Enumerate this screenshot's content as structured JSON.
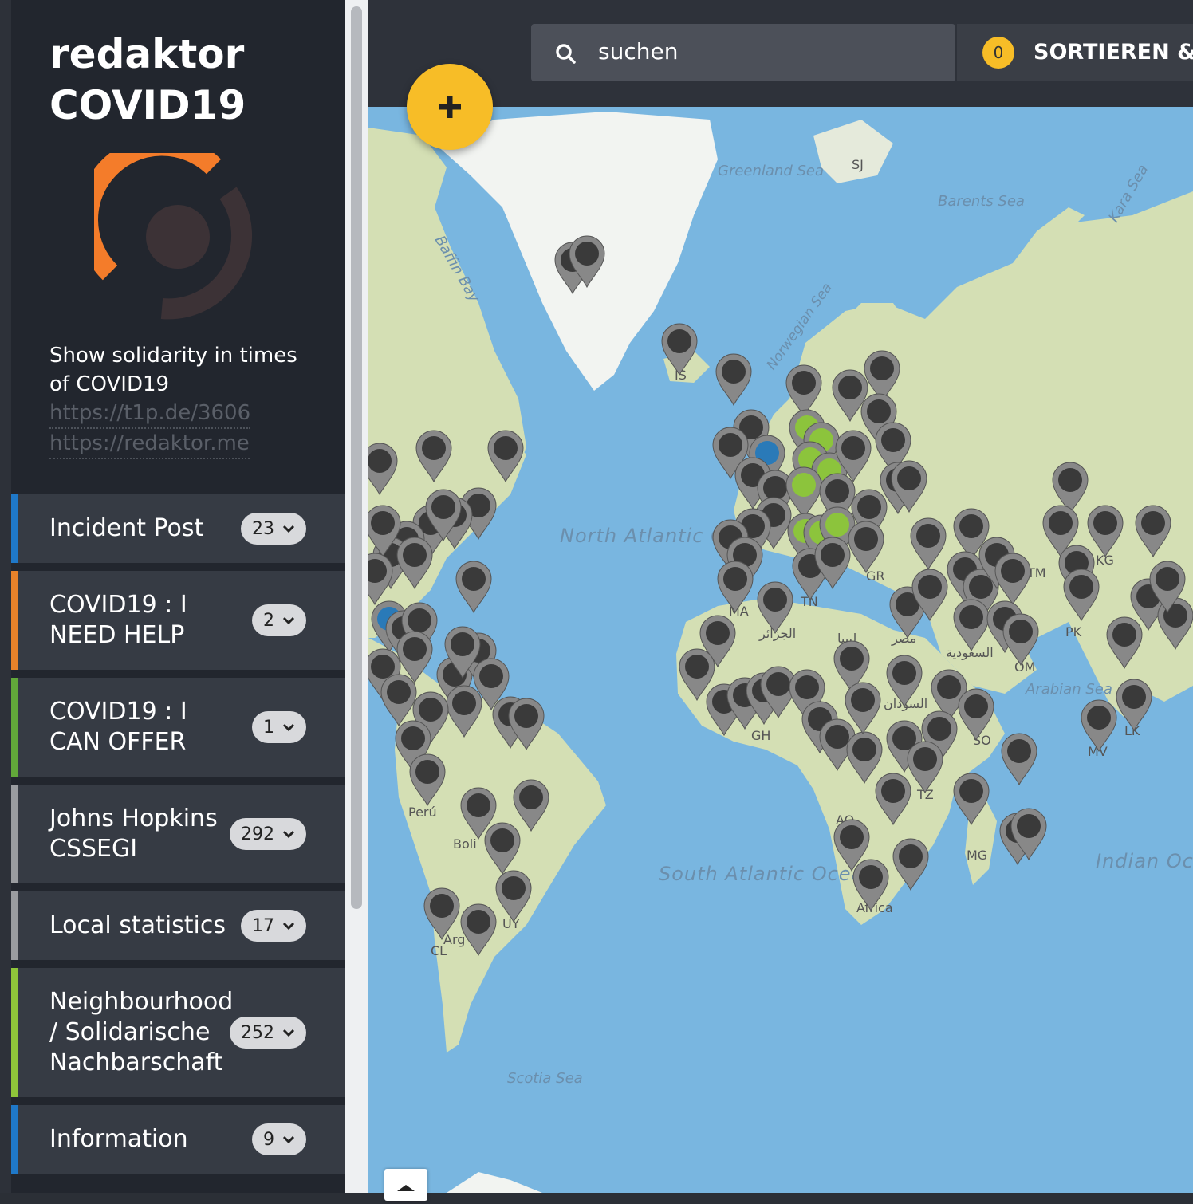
{
  "sidebar": {
    "brand_line1": "redaktor",
    "brand_line2": "COVID19",
    "description": "Show solidarity in times of COVID19",
    "link1": "https://t1p.de/3606",
    "link2": "https://redaktor.me",
    "categories": [
      {
        "label": "Incident Post",
        "count": "23",
        "color": "#1f78c8"
      },
      {
        "label": "COVID19 : I NEED HELP",
        "count": "2",
        "color": "#e8822a"
      },
      {
        "label": "COVID19 : I CAN OFFER",
        "count": "1",
        "color": "#62a83a"
      },
      {
        "label": "Johns Hopkins CSSEGI",
        "count": "292",
        "color": "#9a9ca0"
      },
      {
        "label": "Local statistics",
        "count": "17",
        "color": "#9a9ca0"
      },
      {
        "label": "Neighbourhood / Solidarische Nachbarschaft",
        "count": "252",
        "color": "#8fc53a"
      },
      {
        "label": "Information",
        "count": "9",
        "color": "#1f78c8"
      }
    ]
  },
  "header": {
    "search_placeholder": "suchen",
    "filter_count": "0",
    "sort_label": "SORTIEREN & F"
  },
  "colors": {
    "accent": "#f7bd27",
    "ocean": "#79b6e0",
    "land": "#d4dfb4",
    "ice": "#f2f4f1",
    "marker": "#3a3a3a",
    "marker_green": "#8cc43c",
    "marker_blue": "#2a7ab8"
  },
  "map": {
    "labels": {
      "north_atlantic": "North Atlantic Ocean",
      "south_atlantic": "South Atlantic Ocean",
      "indian": "Indian Ocean",
      "greenland_sea": "Greenland Sea",
      "barents_sea": "Barents Sea",
      "kara_sea": "Kara Sea",
      "baffin_bay": "Baffin Bay",
      "norwegian_sea": "Norwegian Sea",
      "arabian_sea": "Arabian Sea",
      "scotia_sea": "Scotia Sea",
      "peru": "Perú",
      "bolivia": "Boli",
      "argentina": "Arg",
      "africa": "Africa",
      "mg": "MG",
      "sj": "SJ",
      "gr": "GR",
      "pk": "PK",
      "om": "OM",
      "tm": "TM",
      "kg": "KG",
      "lk": "LK",
      "mv": "MV",
      "so": "SO",
      "tz": "TZ",
      "cl": "CL",
      "uy": "UY",
      "gh": "GH",
      "ao": "AO",
      "ma": "MA",
      "tn": "TN",
      "is": "IS",
      "algeria": "الجزائر",
      "libya": "ليبيا",
      "egypt": "مصر",
      "sudan": "السودان",
      "saudi": "السعودية"
    }
  }
}
